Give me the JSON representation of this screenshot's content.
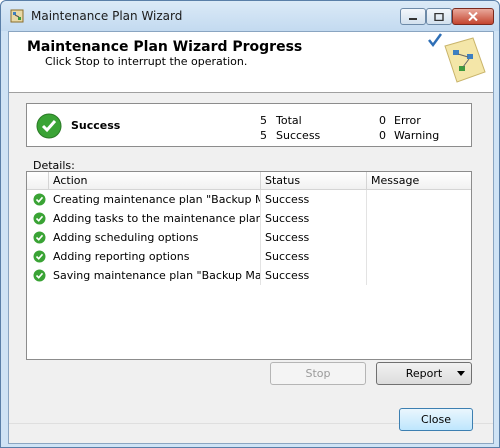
{
  "window": {
    "title": "Maintenance Plan Wizard",
    "icon": "wizard-app-icon",
    "caption_buttons": [
      "minimize-icon",
      "maximize-icon",
      "close-icon"
    ]
  },
  "header": {
    "title": "Maintenance Plan Wizard Progress",
    "subtitle": "Click Stop to interrupt the operation.",
    "art_icon": "flowchart-check-icon"
  },
  "summary": {
    "status": "Success",
    "status_icon": "success-check-icon",
    "total_count": "5",
    "total_label": "Total",
    "success_count": "5",
    "success_label": "Success",
    "error_count": "0",
    "error_label": "Error",
    "warning_count": "0",
    "warning_label": "Warning"
  },
  "details": {
    "label": "Details:",
    "columns": [
      "Action",
      "Status",
      "Message"
    ],
    "rows": [
      {
        "action": "Creating maintenance plan \"Backup Ma...",
        "status": "Success",
        "message": ""
      },
      {
        "action": "Adding tasks to the maintenance plan",
        "status": "Success",
        "message": ""
      },
      {
        "action": "Adding scheduling options",
        "status": "Success",
        "message": ""
      },
      {
        "action": "Adding reporting options",
        "status": "Success",
        "message": ""
      },
      {
        "action": "Saving maintenance plan \"Backup Mait...",
        "status": "Success",
        "message": ""
      }
    ]
  },
  "buttons": {
    "stop": "Stop",
    "report": "Report",
    "close": "Close"
  },
  "colors": {
    "success_green": "#3aa335",
    "title_bar": "#c3daf0",
    "accent_blue": "#3c7fb1"
  }
}
